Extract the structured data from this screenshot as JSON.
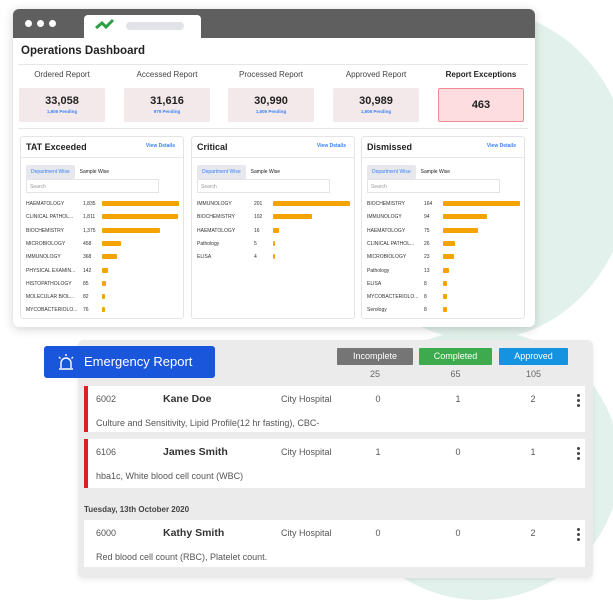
{
  "window": {
    "title": "Operations Dashboard"
  },
  "stats": [
    {
      "label": "Ordered Report",
      "value": "33,058",
      "pending": "1,606 Pending"
    },
    {
      "label": "Accessed Report",
      "value": "31,616",
      "pending": "979 Pending"
    },
    {
      "label": "Processed Report",
      "value": "30,990",
      "pending": "1,605 Pending"
    },
    {
      "label": "Approved Report",
      "value": "30,989",
      "pending": "1,606 Pending"
    },
    {
      "label": "Report Exceptions",
      "value": "463"
    }
  ],
  "panels": [
    {
      "title": "TAT Exceeded",
      "view": "View Details",
      "tab1": "Department Wise",
      "tab2": "Sample Wise",
      "search_placeholder": "Search",
      "max": 1835,
      "rows": [
        {
          "name": "HAEMATOLOGY",
          "value": 1835,
          "label": "1,835"
        },
        {
          "name": "CLINICAL PATHOL...",
          "value": 1811,
          "label": "1,811"
        },
        {
          "name": "BIOCHEMISTRY",
          "value": 1375,
          "label": "1,375"
        },
        {
          "name": "MICROBIOLOGY",
          "value": 458,
          "label": "458"
        },
        {
          "name": "IMMUNOLOGY",
          "value": 368,
          "label": "368"
        },
        {
          "name": "PHYSICAL EXAMIN...",
          "value": 142,
          "label": "142"
        },
        {
          "name": "HISTOPATHOLOGY",
          "value": 85,
          "label": "85"
        },
        {
          "name": "MOLECULAR BIOL...",
          "value": 82,
          "label": "82"
        },
        {
          "name": "MYCOBACTERIOLO...",
          "value": 76,
          "label": "76"
        }
      ]
    },
    {
      "title": "Critical",
      "view": "View Details",
      "tab1": "Department Wise",
      "tab2": "Sample Wise",
      "search_placeholder": "Search",
      "max": 201,
      "rows": [
        {
          "name": "IMMUNOLOGY",
          "value": 201,
          "label": "201"
        },
        {
          "name": "BIOCHEMISTRY",
          "value": 102,
          "label": "102"
        },
        {
          "name": "HAEMATOLOGY",
          "value": 16,
          "label": "16"
        },
        {
          "name": "Pathology",
          "value": 5,
          "label": "5"
        },
        {
          "name": "ELISA",
          "value": 4,
          "label": "4"
        }
      ]
    },
    {
      "title": "Dismissed",
      "view": "View Details",
      "tab1": "Department Wise",
      "tab2": "Sample Wise",
      "search_placeholder": "Search",
      "max": 164,
      "rows": [
        {
          "name": "BIOCHEMISTRY",
          "value": 164,
          "label": "164"
        },
        {
          "name": "IMMUNOLOGY",
          "value": 94,
          "label": "94"
        },
        {
          "name": "HAEMATOLOGY",
          "value": 75,
          "label": "75"
        },
        {
          "name": "CLINICAL PATHOL...",
          "value": 26,
          "label": "26"
        },
        {
          "name": "MICROBIOLOGY",
          "value": 23,
          "label": "23"
        },
        {
          "name": "Pathology",
          "value": 13,
          "label": "13"
        },
        {
          "name": "ELISA",
          "value": 8,
          "label": "8"
        },
        {
          "name": "MYCOBACTERIOLO...",
          "value": 8,
          "label": "8"
        },
        {
          "name": "Serology",
          "value": 8,
          "label": "8"
        }
      ]
    }
  ],
  "emergency": {
    "title": "Emergency Report",
    "badges": [
      {
        "label": "Incomplete",
        "count": "25",
        "color": "#757575"
      },
      {
        "label": "Completed",
        "count": "65",
        "color": "#3daa4e"
      },
      {
        "label": "Approved",
        "count": "105",
        "color": "#1592e0"
      }
    ],
    "rows": [
      {
        "id": "6002",
        "name": "Kane Doe",
        "hospital": "City Hospital",
        "incomplete": "0",
        "completed": "1",
        "approved": "2",
        "tests": "Culture and Sensitivity, Lipid Profile(12 hr fasting), CBC-",
        "urgent": true
      },
      {
        "id": "6106",
        "name": "James Smith",
        "hospital": "City Hospital",
        "incomplete": "1",
        "completed": "0",
        "approved": "1",
        "tests": "hba1c, White blood cell count (WBC)",
        "urgent": true
      }
    ],
    "date_label": "Tuesday, 13th October 2020",
    "dated_rows": [
      {
        "id": "6000",
        "name": "Kathy Smith",
        "hospital": "City Hospital",
        "incomplete": "0",
        "completed": "0",
        "approved": "2",
        "tests": "Red blood cell count (RBC), Platelet count.",
        "urgent": false
      }
    ]
  }
}
